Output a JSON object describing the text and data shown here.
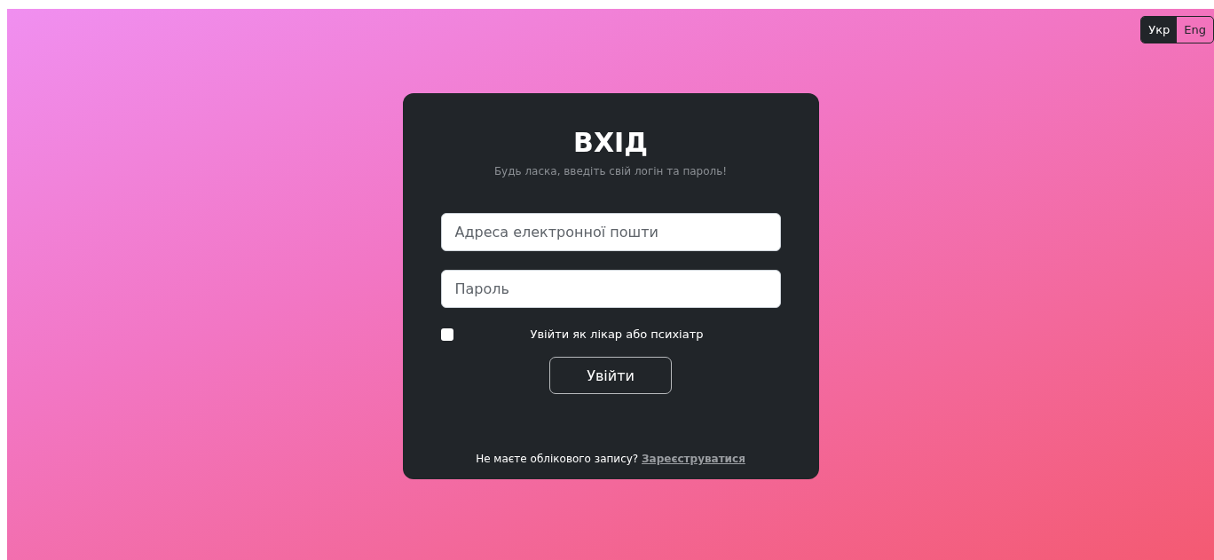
{
  "language_switch": [
    {
      "label": "Укр",
      "selected": true
    },
    {
      "label": "Eng",
      "selected": false
    }
  ],
  "login": {
    "title": "ВХІД",
    "subtitle": "Будь ласка, введіть свій логін та пароль!",
    "email_field": {
      "placeholder": "Адреса електронної пошти"
    },
    "password_field": {
      "placeholder": "Пароль"
    },
    "doctor_checkbox": {
      "label": "Увійти як лікар або психіатр",
      "checked": false
    },
    "submit": "Увійти",
    "signup_prompt": "Не маєте облікового запису?",
    "signup_link": "Зареєструватися"
  }
}
